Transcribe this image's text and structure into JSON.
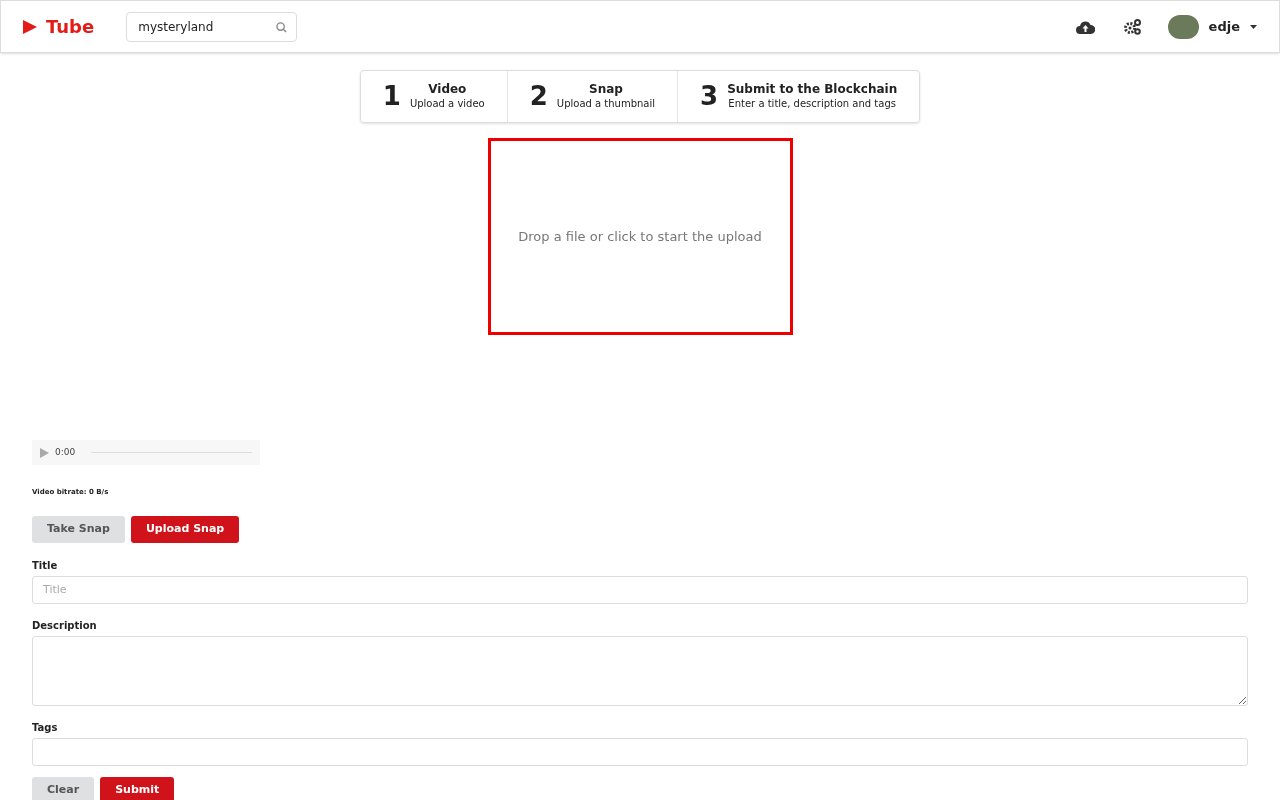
{
  "header": {
    "logo": "Tube",
    "search": {
      "value": "mysteryland"
    },
    "user": {
      "name": "edje"
    }
  },
  "steps": [
    {
      "number": "1",
      "title": "Video",
      "subtitle": "Upload a video"
    },
    {
      "number": "2",
      "title": "Snap",
      "subtitle": "Upload a thumbnail"
    },
    {
      "number": "3",
      "title": "Submit to the Blockchain",
      "subtitle": "Enter a title, description and tags"
    }
  ],
  "dropzone": {
    "text": "Drop a file or click to start the upload"
  },
  "player": {
    "time": "0:00"
  },
  "bitrate": "Video bitrate: 0 B/s",
  "snap_buttons": [
    {
      "label": "Take Snap",
      "kind": "secondary"
    },
    {
      "label": "Upload Snap",
      "kind": "primary"
    }
  ],
  "fields": [
    {
      "label": "Title",
      "kind": "input",
      "placeholder": "Title"
    },
    {
      "label": "Description",
      "kind": "textarea"
    },
    {
      "label": "Tags",
      "kind": "input"
    }
  ],
  "form_buttons": [
    {
      "label": "Clear",
      "kind": "secondary"
    },
    {
      "label": "Submit",
      "kind": "primary"
    }
  ]
}
